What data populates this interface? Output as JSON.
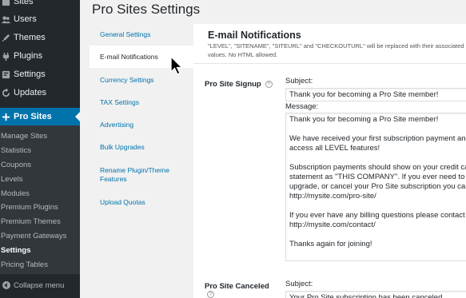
{
  "admin_menu": {
    "items": [
      {
        "label": "Sites",
        "icon": "sites-icon"
      },
      {
        "label": "Users",
        "icon": "users-icon"
      },
      {
        "label": "Themes",
        "icon": "themes-icon"
      },
      {
        "label": "Plugins",
        "icon": "plugins-icon"
      },
      {
        "label": "Settings",
        "icon": "settings-icon"
      },
      {
        "label": "Updates",
        "icon": "updates-icon"
      },
      {
        "label": "Pro Sites",
        "icon": "plus-icon"
      }
    ],
    "submenu": [
      "Manage Sites",
      "Statistics",
      "Coupons",
      "Levels",
      "Modules",
      "Premium Plugins",
      "Premium Themes",
      "Payment Gateways",
      "Settings",
      "Pricing Tables"
    ],
    "collapse_label": "Collapse menu"
  },
  "page": {
    "title": "Pro Sites Settings"
  },
  "tabs": [
    "General Settings",
    "E-mail Notifications",
    "Currency Settings",
    "TAX Settings",
    "Advertising",
    "Bulk Upgrades",
    "Rename Plugin/Theme Features",
    "Upload Quotas"
  ],
  "section": {
    "title": "E-mail Notifications",
    "description": "\"LEVEL\", \"SITENAME\", \"SITEURL\" and \"CHECKOUTURL\" will be replaced with their associated values. No HTML allowed."
  },
  "signup": {
    "label": "Pro Site Signup",
    "subject_label": "Subject:",
    "subject_value": "Thank you for becoming a Pro Site member!",
    "message_label": "Message:",
    "message_lines": [
      "Thank you for becoming a Pro Site member!",
      "",
      "We have received your first subscription payment and you can now",
      "access all LEVEL features!",
      "",
      "Subscription payments should show on your credit card or bank",
      "statement as \"THIS COMPANY\". If you ever need to view, modify,",
      "upgrade, or cancel your Pro Site subscription you can do so here:",
      "http://mysite.com/pro-site/",
      "",
      "If you ever have any billing questions please contact us:",
      "http://mysite.com/contact/",
      "",
      "Thanks again for joining!"
    ]
  },
  "canceled": {
    "label": "Pro Site Canceled",
    "subject_label": "Subject:",
    "subject_value": "Your Pro Site subscription has been canceled"
  },
  "colors": {
    "sidebar": "#23282d",
    "submenu": "#32373c",
    "accent": "#0073aa"
  }
}
